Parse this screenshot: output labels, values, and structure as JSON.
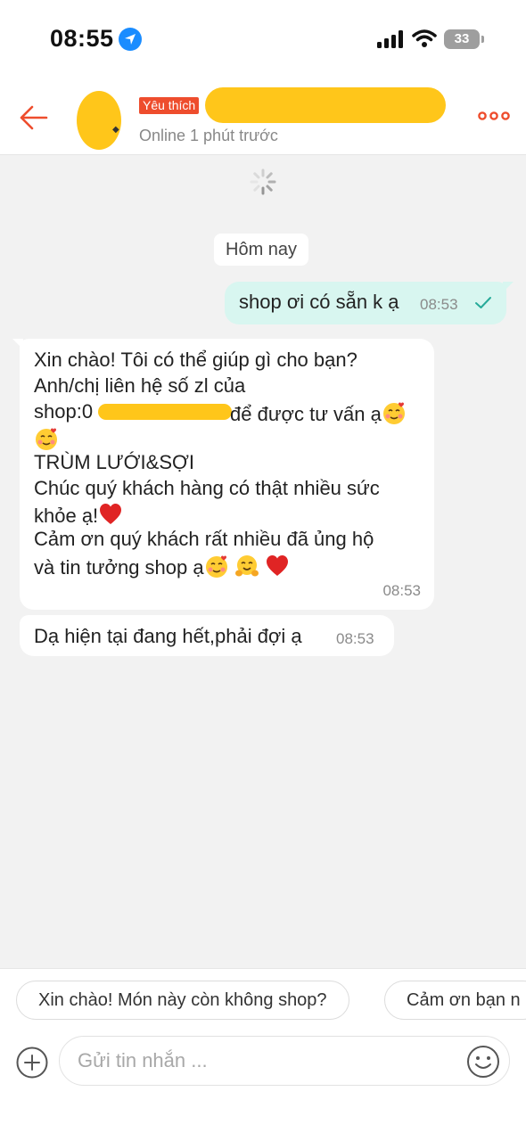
{
  "status_bar": {
    "time": "08:55",
    "battery": "33"
  },
  "header": {
    "favorite_badge": "Yêu thích",
    "online_status": "Online 1 phút trước"
  },
  "chat": {
    "date_separator": "Hôm nay",
    "outgoing": {
      "text": "shop ơi có sẵn k ạ",
      "time": "08:53"
    },
    "incoming_1": {
      "line1": "Xin chào! Tôi có thể giúp gì cho bạn?",
      "line2": "Anh/chị liên hệ số zl của",
      "line3_prefix": "shop:0",
      "line3_suffix": "để được tư vấn ạ",
      "line5": "TRÙM LƯỚI&SỢI",
      "line6": "Chúc quý khách hàng có thật nhiều sức",
      "line7": "khỏe ạ!",
      "line8": "Cảm ơn quý khách rất nhiều đã ủng hộ",
      "line9": "và tin tưởng shop ạ",
      "time": "08:53"
    },
    "incoming_2": {
      "text": "Dạ hiện tại đang hết,phải đợi ạ",
      "time": "08:53"
    }
  },
  "quick_replies": [
    "Xin chào! Món này còn không shop?",
    "Cảm ơn bạn n"
  ],
  "composer": {
    "placeholder": "Gửi tin nhắn ..."
  },
  "colors": {
    "accent": "#ee4d2d",
    "outgoing_bubble": "#d8f6f0",
    "check": "#26aa99",
    "redaction": "#ffc61a"
  },
  "icons": [
    "location-arrow-icon",
    "signal-icon",
    "wifi-icon",
    "battery-icon",
    "back-arrow-icon",
    "more-icon",
    "loading-spinner-icon",
    "read-check-icon",
    "smiling-hearts-emoji",
    "red-heart-emoji",
    "hugging-face-emoji",
    "plus-icon",
    "smiley-icon"
  ]
}
